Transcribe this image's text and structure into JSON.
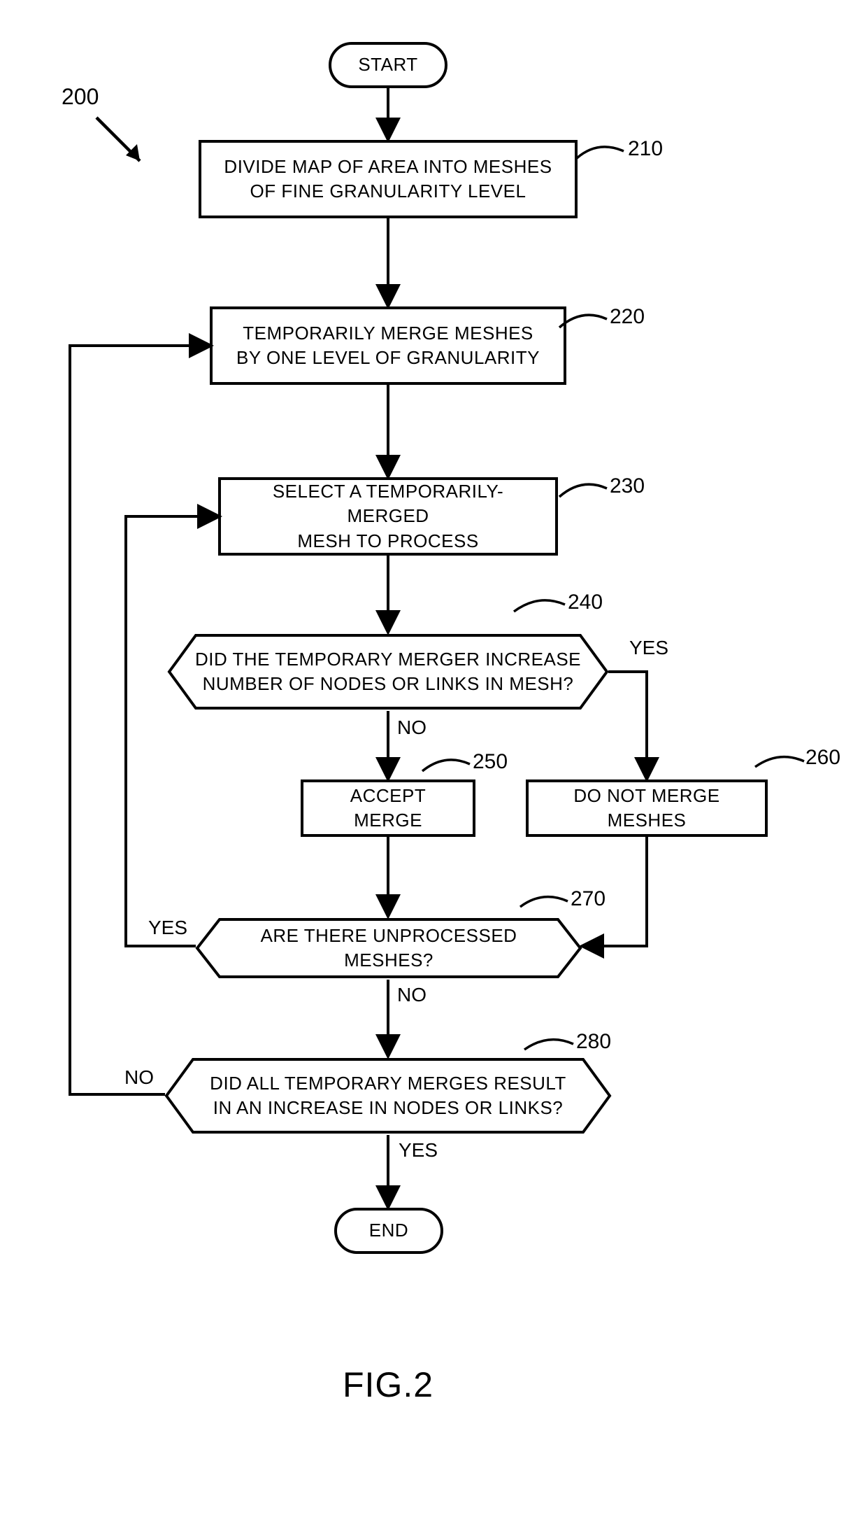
{
  "figure": "FIG.2",
  "flowchart_ref": "200",
  "nodes": {
    "start": {
      "label": "START"
    },
    "n210": {
      "ref": "210",
      "label": "DIVIDE MAP OF AREA INTO MESHES\nOF FINE GRANULARITY LEVEL"
    },
    "n220": {
      "ref": "220",
      "label": "TEMPORARILY MERGE MESHES\nBY ONE LEVEL OF GRANULARITY"
    },
    "n230": {
      "ref": "230",
      "label": "SELECT A TEMPORARILY-MERGED\nMESH TO PROCESS"
    },
    "n240": {
      "ref": "240",
      "label": "DID THE TEMPORARY MERGER INCREASE\nNUMBER OF NODES OR LINKS IN MESH?"
    },
    "n250": {
      "ref": "250",
      "label": "ACCEPT MERGE"
    },
    "n260": {
      "ref": "260",
      "label": "DO NOT MERGE MESHES"
    },
    "n270": {
      "ref": "270",
      "label": "ARE THERE UNPROCESSED MESHES?"
    },
    "n280": {
      "ref": "280",
      "label": "DID ALL TEMPORARY MERGES RESULT\nIN AN INCREASE IN NODES OR LINKS?"
    },
    "end": {
      "label": "END"
    }
  },
  "edge_labels": {
    "n240_yes": "YES",
    "n240_no": "NO",
    "n270_yes": "YES",
    "n270_no": "NO",
    "n280_yes": "YES",
    "n280_no": "NO"
  }
}
